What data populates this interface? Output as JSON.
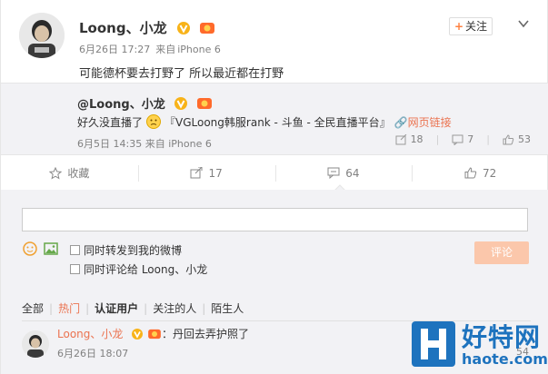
{
  "post": {
    "author": "Loong、小龙",
    "date": "6月26日 17:27",
    "source_prefix": "来自",
    "source": "iPhone 6",
    "text": "可能德杯要去打野了 所以最近都在打野",
    "follow_label": "关注"
  },
  "repost": {
    "mention": "@Loong、小龙",
    "text_before": "好久没直播了",
    "text_after": "『VGLoong韩服rank - 斗鱼 - 全民直播平台』",
    "link_label": "网页链接",
    "date": "6月5日 14:35",
    "source_prefix": "来自",
    "source": "iPhone 6",
    "stats": {
      "repost": "18",
      "comment": "7",
      "like": "53"
    }
  },
  "actions": {
    "favorite_label": "收藏",
    "repost_count": "17",
    "comment_count": "64",
    "like_count": "72"
  },
  "compose": {
    "input_placeholder": "",
    "option_repost": "同时转发到我的微博",
    "option_comment": "同时评论给 Loong、小龙",
    "submit_label": "评论"
  },
  "tabs": {
    "all": "全部",
    "hot": "热门",
    "verified": "认证用户",
    "following": "关注的人",
    "strangers": "陌生人"
  },
  "comment": {
    "author": "Loong、小龙",
    "text": "：丹回去弄护照了",
    "time": "6月26日 18:07",
    "stat": "54"
  },
  "watermark": {
    "text": "好特网",
    "url": "haote.com"
  },
  "colors": {
    "accent": "#eb7350",
    "background": "#f2f2f5",
    "submit_disabled": "#fbc7ab",
    "watermark": "#1e73be"
  }
}
